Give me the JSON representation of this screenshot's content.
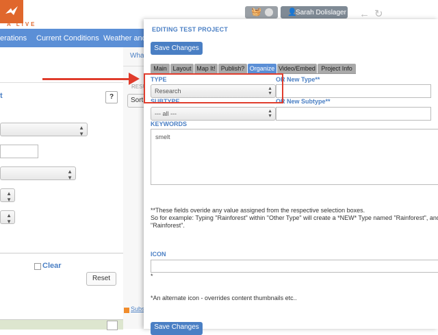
{
  "header": {
    "logo_text": "A LIVE",
    "user_name": "Sarah Dolislager"
  },
  "nav": {
    "items": [
      "erations",
      "Current Conditions",
      "Weather and T"
    ]
  },
  "left_panel": {
    "section_label": "t",
    "help_label": "?",
    "clear_label": "Clear",
    "reset_label": "Reset"
  },
  "mid_panel": {
    "tab_label": "What",
    "results_label": "RESU",
    "sort_label": "Sort",
    "subscribe_label": "Subs"
  },
  "modal": {
    "title": "EDITING TEST PROJECT",
    "save_label": "Save Changes",
    "tabs": [
      {
        "label": "Main",
        "active": false
      },
      {
        "label": "Layout",
        "active": false
      },
      {
        "label": "Map It!",
        "active": false
      },
      {
        "label": "Publish?",
        "active": false
      },
      {
        "label": "Organize",
        "active": true
      },
      {
        "label": "Video/Embed",
        "active": false
      },
      {
        "label": "Project Info",
        "active": false
      }
    ],
    "type_label": "TYPE",
    "type_value": "Research",
    "new_type_label": "OR New Type**",
    "subtype_label": "SUBTYPE",
    "subtype_value": "--- all ---",
    "new_subtype_label": "OR New Subtype**",
    "keywords_label": "KEYWORDS",
    "keywords_value": "smelt",
    "note_line1": "**These fields overide any value assigned from the respective selection boxes.",
    "note_line2": "So for example: Typing \"Rainforest\" within \"Other Type\" will create a *NEW* Type named \"Rainforest\", and",
    "note_line3": "\"Rainforest\".",
    "icon_label": "ICON",
    "icon_asterisk": "*",
    "icon_note": "*An alternate icon - overrides content thumbnails etc.."
  },
  "colors": {
    "nav_bg": "#5b8fd6",
    "accent": "#4a7fc4",
    "brand": "#e0672c",
    "annotation": "#e03c2c"
  }
}
